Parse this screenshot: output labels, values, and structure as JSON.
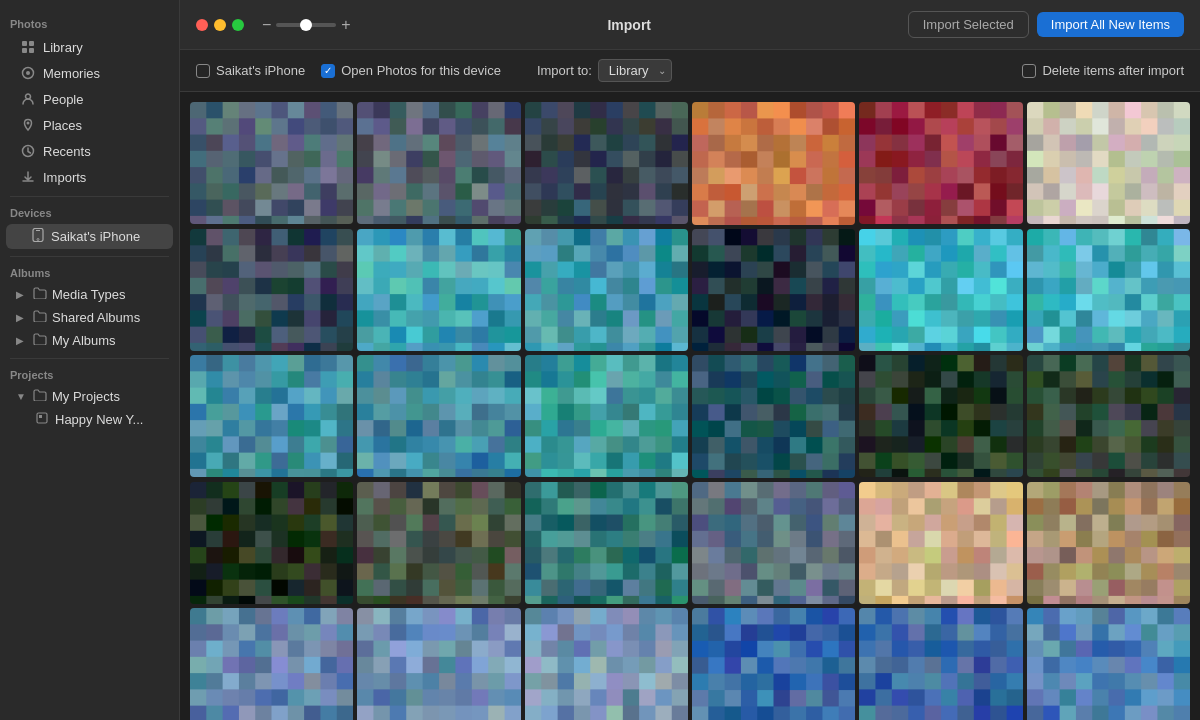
{
  "window": {
    "title": "Import"
  },
  "topbar": {
    "title": "Import",
    "slider_min": "−",
    "slider_max": "+",
    "btn_import_selected": "Import Selected",
    "btn_import_all": "Import All New Items"
  },
  "import_bar": {
    "device_label": "Saikat's iPhone",
    "open_photos_label": "Open Photos for this device",
    "open_photos_checked": true,
    "import_to_label": "Import to:",
    "import_to_value": "Library",
    "delete_after_label": "Delete items after import",
    "delete_checked": false
  },
  "sidebar": {
    "photos_section": "Photos",
    "items": [
      {
        "id": "library",
        "label": "Library",
        "icon": "⬛"
      },
      {
        "id": "memories",
        "label": "Memories",
        "icon": "⭕"
      },
      {
        "id": "people",
        "label": "People",
        "icon": "👤"
      },
      {
        "id": "places",
        "label": "Places",
        "icon": "📍"
      },
      {
        "id": "recents",
        "label": "Recents",
        "icon": "🕐"
      },
      {
        "id": "imports",
        "label": "Imports",
        "icon": "📥"
      }
    ],
    "devices_section": "Devices",
    "device_name": "Saikat's iPhone",
    "albums_section": "Albums",
    "albums": [
      {
        "id": "media-types",
        "label": "Media Types"
      },
      {
        "id": "shared-albums",
        "label": "Shared Albums"
      },
      {
        "id": "my-albums",
        "label": "My Albums"
      }
    ],
    "projects_section": "Projects",
    "my_projects": "My Projects",
    "project_items": [
      {
        "id": "happy-new",
        "label": "Happy New Y..."
      }
    ]
  },
  "photos": {
    "count": 30,
    "colors": [
      [
        "#4a5a6a",
        "#3a4a5a",
        "#5a6a7a",
        "#6a7a8a"
      ],
      [
        "#5a6a7a",
        "#4a5a6a",
        "#6a7a8a",
        "#3a4a5a"
      ],
      [
        "#2a3a4a",
        "#3a4a5a",
        "#4a5a6a",
        "#2a3040"
      ],
      [
        "#c8704a",
        "#d08050",
        "#b86040",
        "#e09060"
      ],
      [
        "#8a2a3a",
        "#9a3a4a",
        "#7a1a2a",
        "#b04a5a"
      ],
      [
        "#c8c0b0",
        "#d0c8b8",
        "#e0d8c8",
        "#b8b0a0"
      ],
      [
        "#304050",
        "#405060",
        "#506070",
        "#203040"
      ],
      [
        "#3a9ab0",
        "#4aaac0",
        "#2a8aa0",
        "#5abac0"
      ],
      [
        "#4a9ab0",
        "#3a8aa0",
        "#5aaac0",
        "#208090"
      ],
      [
        "#1a2a3a",
        "#2a3a4a",
        "#0a1a2a",
        "#3a4a5a"
      ],
      [
        "#3ab0c0",
        "#4ac0d0",
        "#2aa0b0",
        "#5ad0e0"
      ],
      [
        "#5ab8c8",
        "#3aa8b8",
        "#6ac8d8",
        "#2898a8"
      ],
      [
        "#3a8898",
        "#4a98a8",
        "#2a7888",
        "#5aa8b8"
      ],
      [
        "#4890a0",
        "#3880a0",
        "#58a0b0",
        "#287090"
      ],
      [
        "#3a9898",
        "#4aa8a8",
        "#2a8888",
        "#5ab8b8"
      ],
      [
        "#184858",
        "#284858",
        "#085058",
        "#386878"
      ],
      [
        "#1a3020",
        "#2a4030",
        "#0a2010",
        "#3a5040"
      ],
      [
        "#2a4030",
        "#384840",
        "#1a3020",
        "#4a5848"
      ],
      [
        "#1a2818",
        "#2a3828",
        "#0a1808",
        "#3a4838"
      ],
      [
        "#445040",
        "#546050",
        "#344030",
        "#647060"
      ],
      [
        "#3a8080",
        "#2a7070",
        "#4a9090",
        "#1a6060"
      ],
      [
        "#506880",
        "#607080",
        "#405870",
        "#708090"
      ],
      [
        "#c8a880",
        "#d8b890",
        "#b89870",
        "#e8c8a0"
      ],
      [
        "#9a8060",
        "#aa9070",
        "#8a7050",
        "#baa080"
      ],
      [
        "#7090b0",
        "#6080a0",
        "#80a0c0",
        "#5070a0"
      ],
      [
        "#6888a8",
        "#7898b8",
        "#5878a8",
        "#88a8c8"
      ],
      [
        "#7090b0",
        "#80a0c0",
        "#6080a0",
        "#90b0c0"
      ],
      [
        "#3060a0",
        "#4070b0",
        "#2050a0",
        "#5080b0"
      ],
      [
        "#4870a8",
        "#3860a0",
        "#5880b0",
        "#2850a0"
      ],
      [
        "#5888b8",
        "#4878a8",
        "#6898c0",
        "#3868a8"
      ]
    ]
  }
}
